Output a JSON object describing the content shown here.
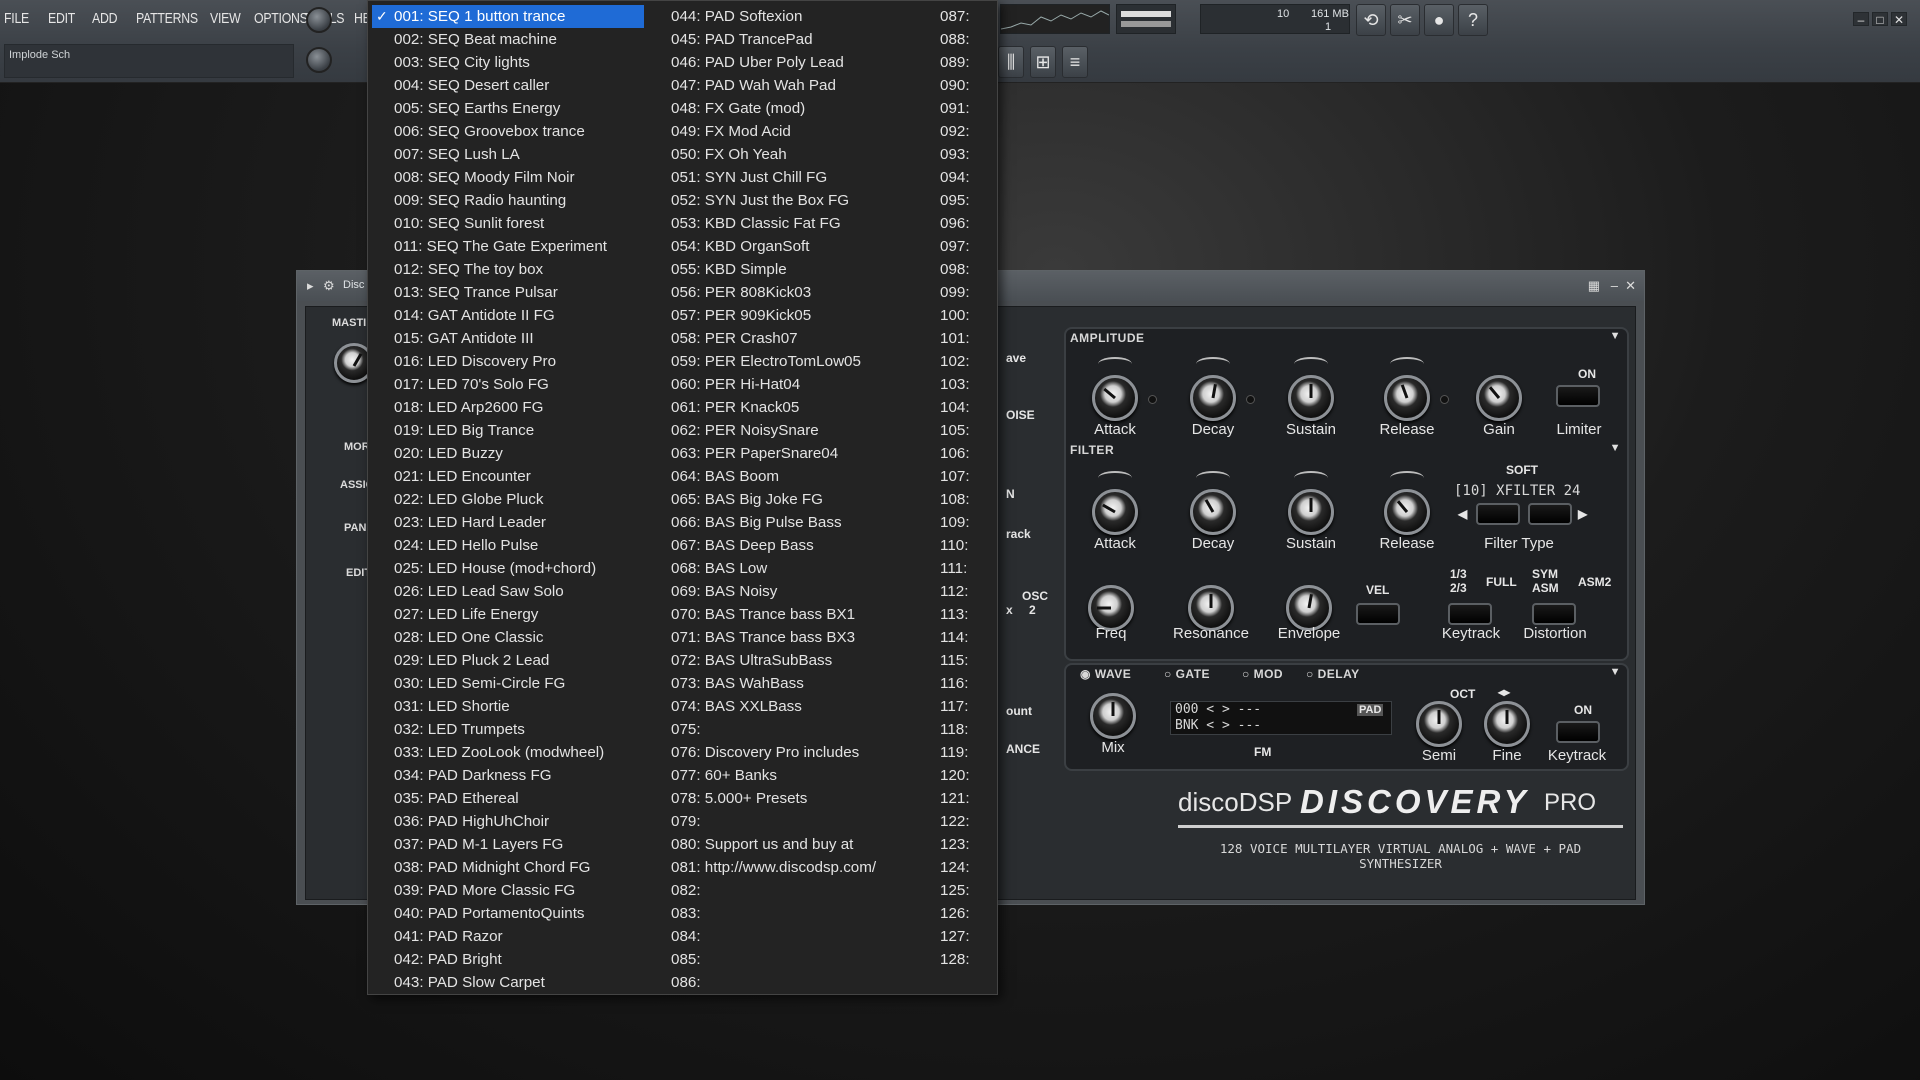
{
  "menubar": [
    "FILE",
    "EDIT",
    "ADD",
    "PATTERNS",
    "VIEW",
    "OPTIONS",
    "TOOLS",
    "HELP"
  ],
  "hint_panel": {
    "text": "Implode Sch"
  },
  "toolbar": {
    "cpu_value": "10",
    "mem_value": "161 MB",
    "poly_value": "1"
  },
  "plugin": {
    "title": "Disc",
    "left_tags": [
      "MASTI",
      "MOR",
      "ASSIG",
      "PANI",
      "EDIT"
    ],
    "partial_labels": [
      "ave",
      "OISE",
      "N",
      "rack",
      "OSC",
      "2",
      "ount",
      "ANCE",
      "x"
    ],
    "amplitude": {
      "header": "AMPLITUDE",
      "knobs": [
        "Attack",
        "Decay",
        "Sustain",
        "Release",
        "Gain"
      ],
      "limiter_label": "Limiter",
      "on_label": "ON"
    },
    "filter": {
      "header": "FILTER",
      "knobs_row1": [
        "Attack",
        "Decay",
        "Sustain",
        "Release"
      ],
      "knobs_row2": [
        "Freq",
        "Resonance",
        "Envelope"
      ],
      "soft_label": "SOFT",
      "filter_type_display": "[10] XFILTER 24",
      "filter_type_label": "Filter Type",
      "vel_label": "VEL",
      "keytrack_label": "Keytrack",
      "keytrack_opts": [
        "1/3",
        "2/3",
        "FULL"
      ],
      "distortion_label": "Distortion",
      "dist_opts": [
        "SYM",
        "ASM",
        "ASM2"
      ]
    },
    "wave": {
      "tabs": [
        "WAVE",
        "GATE",
        "MOD",
        "DELAY"
      ],
      "mix_label": "Mix",
      "lcd_row1": "000 < > ---",
      "lcd_row2": "BNK < > ---",
      "pad_label": "PAD",
      "fm_label": "FM",
      "oct_label": "OCT",
      "semi_label": "Semi",
      "fine_label": "Fine",
      "keytrack_label": "Keytrack",
      "on_label": "ON"
    },
    "brand": {
      "maker": "discoDSP",
      "product": "DISCOVERY",
      "edition": "PRO",
      "tagline": "128 VOICE MULTILAYER VIRTUAL ANALOG + WAVE + PAD SYNTHESIZER"
    }
  },
  "preset_menu": {
    "selected_index": 0,
    "columns": [
      [
        "001: SEQ 1 button trance",
        "002: SEQ Beat machine",
        "003: SEQ City lights",
        "004: SEQ Desert caller",
        "005: SEQ Earths Energy",
        "006: SEQ Groovebox trance",
        "007: SEQ Lush LA",
        "008: SEQ Moody Film Noir",
        "009: SEQ Radio haunting",
        "010: SEQ Sunlit forest",
        "011: SEQ The Gate Experiment",
        "012: SEQ The toy box",
        "013: SEQ Trance Pulsar",
        "014: GAT Antidote II FG",
        "015: GAT Antidote III",
        "016: LED Discovery Pro",
        "017: LED 70's Solo FG",
        "018: LED Arp2600 FG",
        "019: LED Big Trance",
        "020: LED Buzzy",
        "021: LED Encounter",
        "022: LED Globe Pluck",
        "023: LED Hard Leader",
        "024: LED Hello Pulse",
        "025: LED House (mod+chord)",
        "026: LED Lead Saw Solo",
        "027: LED Life Energy",
        "028: LED One Classic",
        "029: LED Pluck 2 Lead",
        "030: LED Semi-Circle FG",
        "031: LED Shortie",
        "032: LED Trumpets",
        "033: LED ZooLook (modwheel)",
        "034: PAD Darkness FG",
        "035: PAD Ethereal",
        "036: PAD HighUhChoir",
        "037: PAD M-1 Layers FG",
        "038: PAD Midnight Chord FG",
        "039: PAD More Classic FG",
        "040: PAD PortamentoQuints",
        "041: PAD Razor",
        "042: PAD Bright",
        "043: PAD Slow Carpet"
      ],
      [
        "044: PAD Softexion",
        "045: PAD TrancePad",
        "046: PAD Uber Poly Lead",
        "047: PAD Wah Wah Pad",
        "048: FX Gate (mod)",
        "049: FX Mod Acid",
        "050: FX Oh Yeah",
        "051: SYN Just Chill FG",
        "052: SYN Just the Box FG",
        "053: KBD Classic Fat FG",
        "054: KBD OrganSoft",
        "055: KBD Simple",
        "056: PER 808Kick03",
        "057: PER 909Kick05",
        "058: PER Crash07",
        "059: PER ElectroTomLow05",
        "060: PER Hi-Hat04",
        "061: PER Knack05",
        "062: PER NoisySnare",
        "063: PER PaperSnare04",
        "064: BAS Boom",
        "065: BAS Big Joke FG",
        "066: BAS Big Pulse Bass",
        "067: BAS Deep Bass",
        "068: BAS Low",
        "069: BAS Noisy",
        "070: BAS Trance bass BX1",
        "071: BAS Trance bass BX3",
        "072: BAS UltraSubBass",
        "073: BAS WahBass",
        "074: BAS XXLBass",
        "075:",
        "076: Discovery Pro includes",
        "077: 60+ Banks",
        "078: 5.000+ Presets",
        "079:",
        "080: Support us and buy at",
        "081: http://www.discodsp.com/",
        "082:",
        "083:",
        "084:",
        "085:",
        "086:"
      ],
      [
        "087:",
        "088:",
        "089:",
        "090:",
        "091:",
        "092:",
        "093:",
        "094:",
        "095:",
        "096:",
        "097:",
        "098:",
        "099:",
        "100:",
        "101:",
        "102:",
        "103:",
        "104:",
        "105:",
        "106:",
        "107:",
        "108:",
        "109:",
        "110:",
        "111:",
        "112:",
        "113:",
        "114:",
        "115:",
        "116:",
        "117:",
        "118:",
        "119:",
        "120:",
        "121:",
        "122:",
        "123:",
        "124:",
        "125:",
        "126:",
        "127:",
        "128:"
      ]
    ]
  }
}
